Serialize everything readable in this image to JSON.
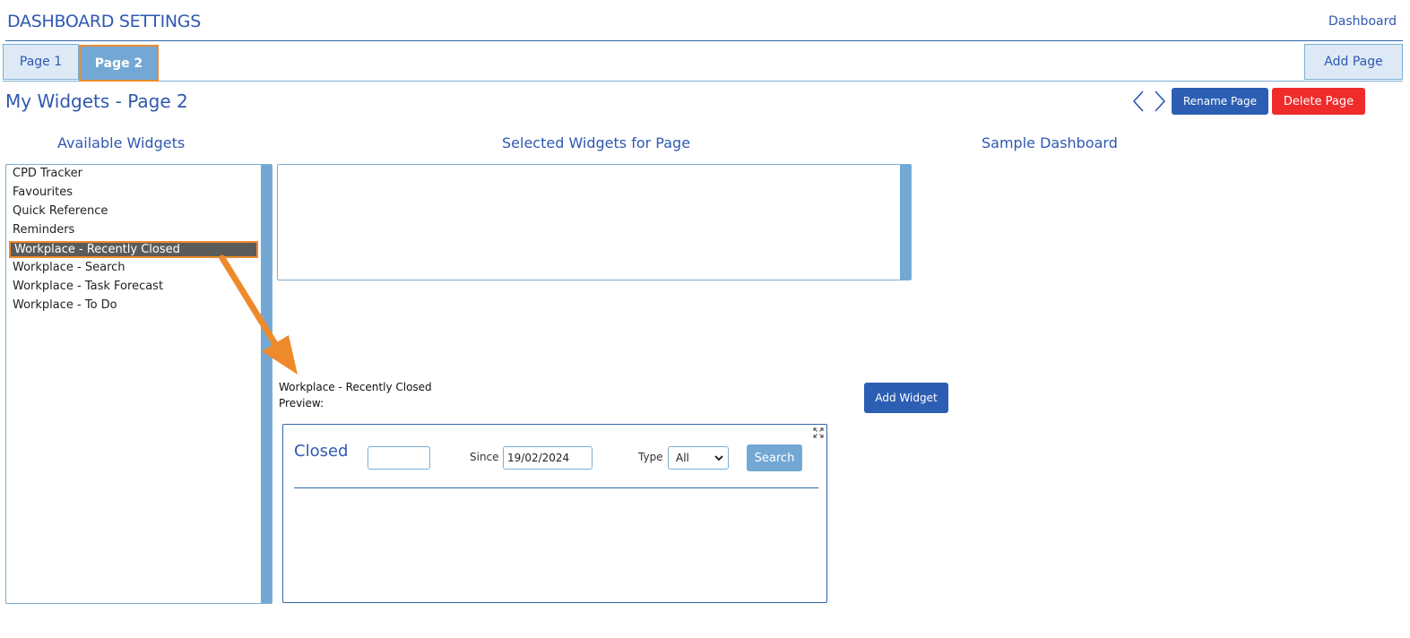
{
  "header": {
    "title": "DASHBOARD SETTINGS",
    "dashboard_link": "Dashboard"
  },
  "tabs": [
    {
      "label": "Page 1",
      "active": false
    },
    {
      "label": "Page 2",
      "active": true
    }
  ],
  "add_page_label": "Add Page",
  "page_title": "My Widgets - Page 2",
  "toolbar": {
    "rename_label": "Rename Page",
    "delete_label": "Delete Page"
  },
  "columns": {
    "available": "Available Widgets",
    "selected": "Selected Widgets for Page",
    "sample": "Sample Dashboard"
  },
  "available_widgets": [
    {
      "label": "CPD Tracker",
      "selected": false
    },
    {
      "label": "Favourites",
      "selected": false
    },
    {
      "label": "Quick Reference",
      "selected": false
    },
    {
      "label": "Reminders",
      "selected": false
    },
    {
      "label": "Workplace - Recently Closed",
      "selected": true
    },
    {
      "label": "Workplace - Search",
      "selected": false
    },
    {
      "label": "Workplace - Task Forecast",
      "selected": false
    },
    {
      "label": "Workplace - To Do",
      "selected": false
    }
  ],
  "preview": {
    "widget_name": "Workplace - Recently Closed",
    "label": "Preview:",
    "add_widget_label": "Add Widget",
    "closed_title": "Closed",
    "closed_value": "",
    "since_label": "Since",
    "since_value": "19/02/2024",
    "type_label": "Type",
    "type_value": "All",
    "search_label": "Search"
  },
  "colors": {
    "accent": "#2f58b1",
    "button_primary": "#2c5fb3",
    "button_danger": "#ef2b2b",
    "highlight": "#ee8a2c",
    "scrollbar": "#73a8d4"
  },
  "icons": [
    "chevron-left-icon",
    "chevron-right-icon",
    "expand-icon",
    "chevron-down-icon",
    "annotation-arrow"
  ]
}
